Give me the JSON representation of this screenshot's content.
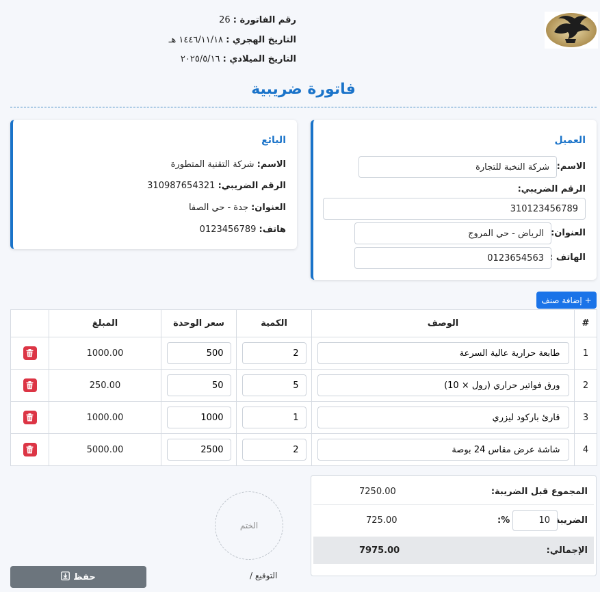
{
  "header": {
    "invoice_no_label": "رقم الفاتورة :",
    "invoice_no": "26",
    "hijri_label": "التاريخ الهجري :",
    "hijri_date": "١٤٤٦/١١/١٨ هـ",
    "gregorian_label": "التاريخ الميلادي :",
    "gregorian_date": "٢٠٢٥/٥/١٦",
    "title": "فاتورة ضريبية"
  },
  "client": {
    "title": "العميل",
    "name_label": "الاسم:",
    "name": "شركة النخبة للتجارة",
    "tax_label": "الرقم الضريبي:",
    "tax_no": "310123456789",
    "address_label": "العنوان:",
    "address": "الرياض - حي المروج",
    "phone_label": "الهاتف :",
    "phone": "0123654563"
  },
  "seller": {
    "title": "البائع",
    "name_label": "الاسم:",
    "name": "شركة التقنية المتطورة",
    "tax_label": "الرقم الضريبي:",
    "tax_no": "310987654321",
    "address_label": "العنوان:",
    "address": "جدة - حي الصفا",
    "phone_label": "هاتف:",
    "phone": "0123456789"
  },
  "add_item_label": "إضافة صنف",
  "add_item_icon": "+",
  "table": {
    "headers": {
      "index": "#",
      "description": "الوصف",
      "quantity": "الكمية",
      "unit_price": "سعر الوحدة",
      "amount": "المبلغ"
    },
    "rows": [
      {
        "index": "1",
        "description": "طابعة حرارية عالية السرعة",
        "quantity": "2",
        "unit_price": "500",
        "amount": "1000.00"
      },
      {
        "index": "2",
        "description": "ورق فواتير حراري (رول × 10)",
        "quantity": "5",
        "unit_price": "50",
        "amount": "250.00"
      },
      {
        "index": "3",
        "description": "قارئ باركود ليزري",
        "quantity": "1",
        "unit_price": "1000",
        "amount": "1000.00"
      },
      {
        "index": "4",
        "description": "شاشة عرض مقاس 24 بوصة",
        "quantity": "2",
        "unit_price": "2500",
        "amount": "5000.00"
      }
    ]
  },
  "totals": {
    "subtotal_label": "المجموع قبل الضريبة:",
    "subtotal": "7250.00",
    "tax_label": "الضريبة",
    "tax_rate": "10",
    "tax_pct": "%:",
    "tax_amount": "725.00",
    "grand_label": "الإجمالي:",
    "grand_total": "7975.00"
  },
  "stamp_label": "الختم",
  "signature_label": "التوقيع /",
  "save_label": "حفظ",
  "colors": {
    "accent": "#1a73c9",
    "button_primary": "#1a73e8",
    "danger": "#dc3545",
    "save": "#6c757d"
  },
  "icons": {
    "logo": "eagle-logo",
    "delete": "trash-icon",
    "save": "save-icon",
    "add": "plus-icon"
  }
}
